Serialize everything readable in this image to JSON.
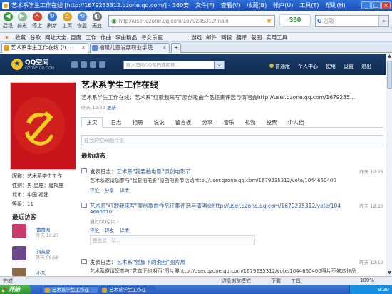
{
  "window": {
    "title": "艺术系学生工作在线 [http://1679235312.qzone.qq.com/] - 360安全浏览器 3.6...",
    "menu": [
      "文件(F)",
      "查看(V)",
      "收藏(B)",
      "帐户(U)",
      "工具(T)",
      "帮助(H)"
    ],
    "controls": [
      "_",
      "□",
      "×"
    ]
  },
  "toolbar": {
    "buttons": [
      "后退",
      "前进",
      "停止",
      "刷新",
      "主页",
      "恢复",
      "无痕"
    ],
    "address": "http://user.qzone.qq.com/1679235312/main",
    "brand": "360",
    "search_engine": "G",
    "search_placeholder": "谷歌"
  },
  "favorites_bar": [
    "收藏",
    "谷歌",
    "网址大全",
    "百度",
    "工作",
    "作曲",
    "李由精品",
    "寻女乐室",
    "游戏",
    "邮件",
    "网银",
    "翻译",
    "截图",
    "实用工具"
  ],
  "tabs": [
    {
      "label": "艺术系学生工作在线 [h..."
    },
    {
      "label": "福建儿童发展职业学院"
    }
  ],
  "qzone": {
    "logo": "QQ空间",
    "logo_sub": "QZONE.QQ.COM",
    "search_placeholder": "输入您的QQ号码或昵称...",
    "search_button": "⌕",
    "nav": [
      "普通版",
      "个人中心",
      "使用",
      "设置",
      "退出"
    ]
  },
  "profile": {
    "title": "艺术系学生工作在线",
    "subtitle": "艺术系学生工作在线：艺术系\"红歌我来写\"原创歌曲作品征集评选与演唱会http://user.qzone.qq.com/1679235...",
    "meta_time": "昨天 12:23",
    "meta_link": "更新",
    "info": [
      "昵称：艺术系学生工作",
      "性别：男  星座：魔羯座",
      "城市：中国  福建",
      "等级：11"
    ],
    "visitors_title": "最近访客",
    "visitors": [
      {
        "name": "蕾蕾阁",
        "time": "昨天 19:27",
        "color": "#c93b6a"
      },
      {
        "name": "刘芙蓉",
        "time": "昨天 08:58",
        "color": "#6a4a8a"
      },
      {
        "name": "小凡",
        "time": "",
        "color": "#8a6a4a"
      }
    ]
  },
  "main_tabs": [
    "主页",
    "日志",
    "相册",
    "说说",
    "留言板",
    "分享",
    "音乐",
    "礼物",
    "投票",
    "个人档"
  ],
  "status_placeholder": "在我的空间图片说",
  "feed_title": "最新动态",
  "feed": [
    {
      "prefix": "发表日志：",
      "title": "艺术系\"我要拍电影\"原创电影节",
      "time": "昨天 12:25",
      "body": "艺术系邀请您参与\"我要拍电影\"原创电影节活动http://user.qzone.qq.com/1679235312/vote/1044660400",
      "actions": [
        "评论",
        "分享",
        "详情"
      ]
    },
    {
      "prefix": "",
      "title": "艺术系\"红歌我来写\"原创歌曲作品征集评选与演唱会http://user.qzone.qq.com/1679235312/vote/104",
      "title2": "4660570",
      "time": "昨天 12:23",
      "via": "通过QQ空间",
      "actions": [
        "评论",
        "转发",
        "详情"
      ],
      "reply_placeholder": "我也说一句..."
    },
    {
      "prefix": "发表日志：",
      "title": "艺术系\"党旗下的湘西\"图片展",
      "time": "昨天 12:19",
      "body": "艺术系邀请您参与\"党旗下的湘西\"图片展http://user.qzone.qq.com/1679235312/vote/1044660400照片不依本作品"
    }
  ],
  "statusbar": {
    "left": "完成",
    "mode": "切换浏览模式",
    "tools": [
      "下载",
      "工具"
    ],
    "zoom": "100%"
  },
  "taskbar": {
    "start": "开始",
    "items": [
      "艺术系学生工作在",
      "艺术系学生工作在"
    ],
    "clock": "9:30"
  },
  "colors": {
    "titlebar": "#2463c8",
    "qzone_header": "#163560",
    "link": "#2b5a9b",
    "flag_red": "#c7141a"
  }
}
